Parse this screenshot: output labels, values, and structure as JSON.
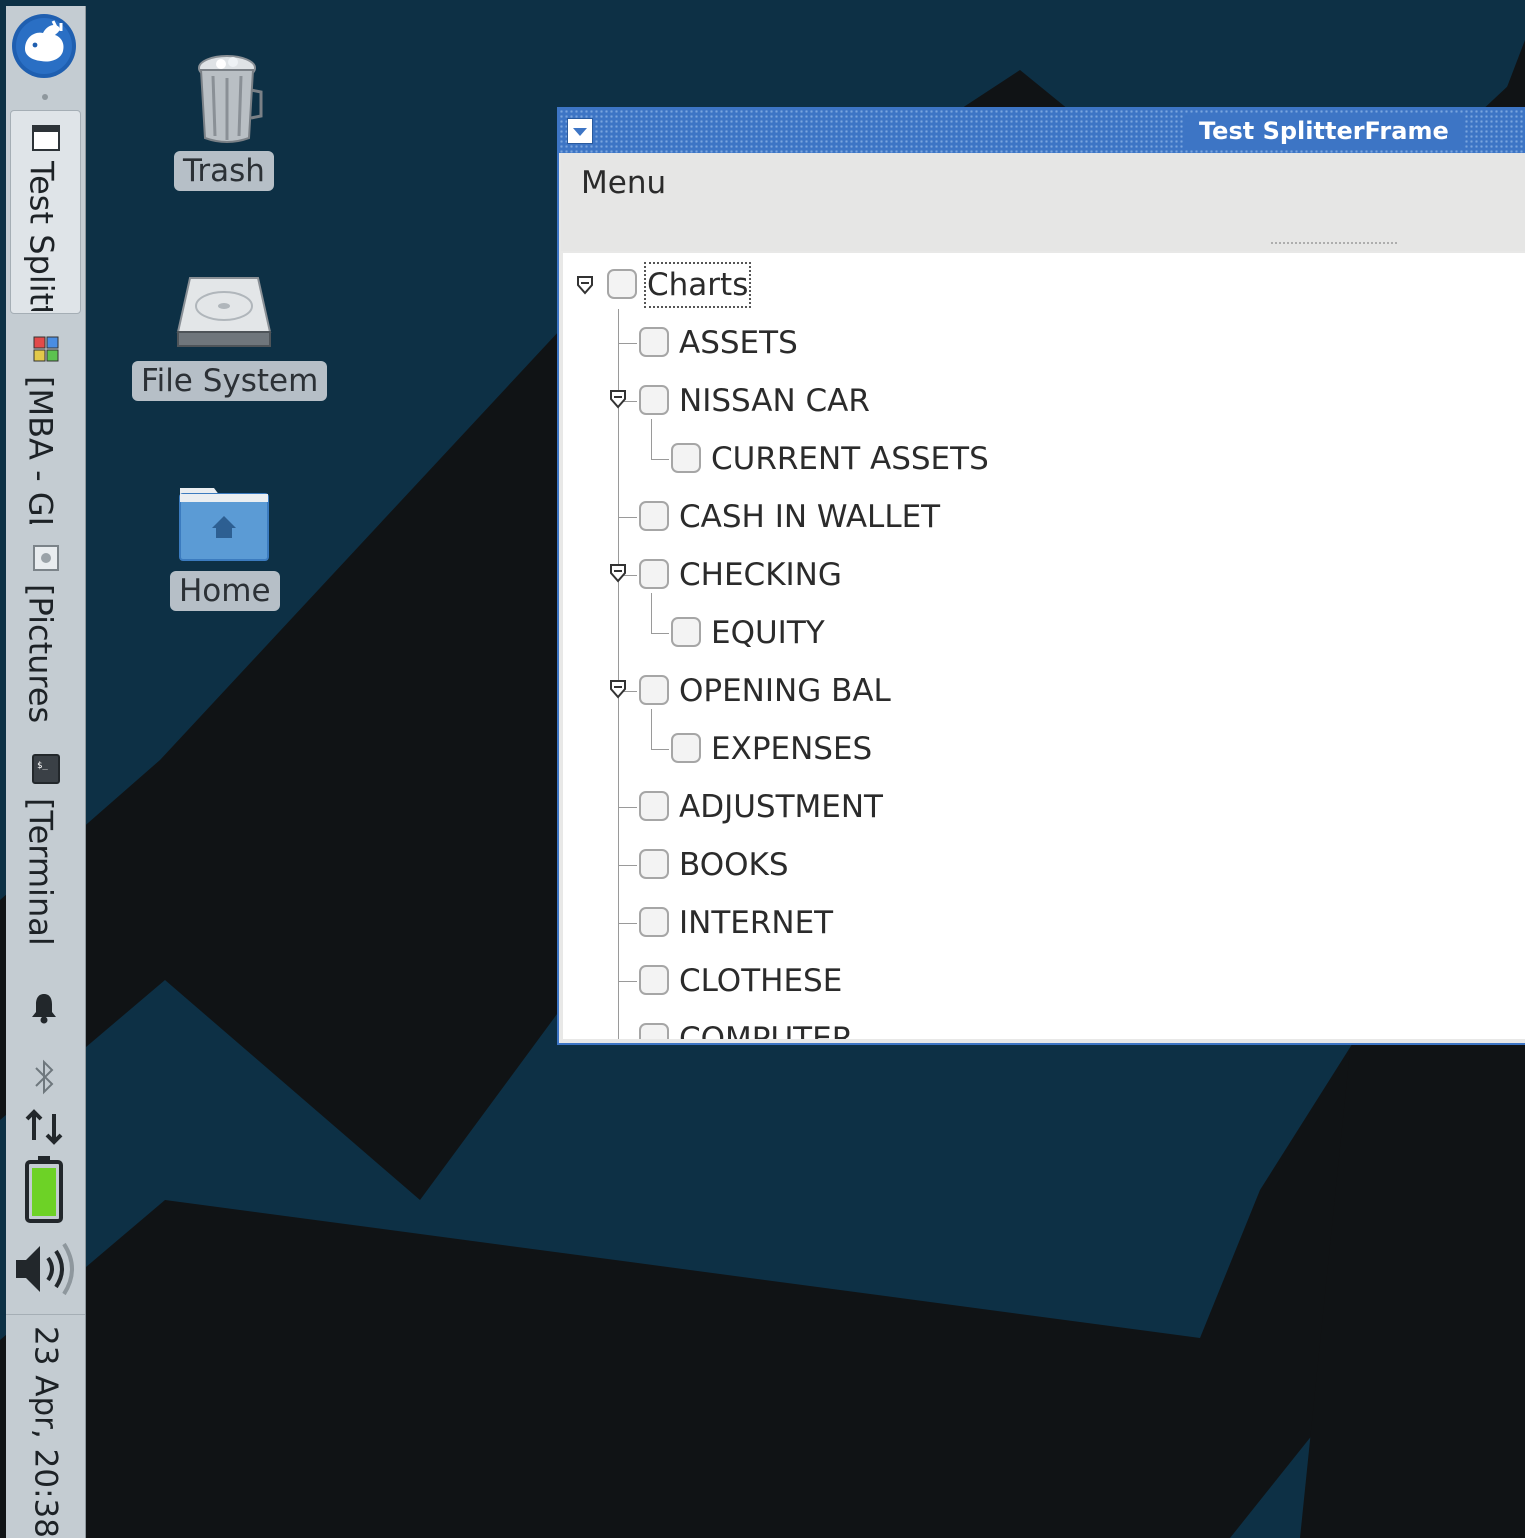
{
  "panel": {
    "tasks": [
      {
        "label": "Test Splitt",
        "icon": "window-icon"
      },
      {
        "label": "[MBA - GL",
        "icon": "app-grid-icon"
      },
      {
        "label": "[Pictures ·",
        "icon": "image-viewer-icon"
      },
      {
        "label": "[Terminal",
        "icon": "terminal-icon"
      }
    ],
    "clock": "23 Apr, 20:38",
    "tray": [
      "notification-bell-icon",
      "bluetooth-icon",
      "network-icon",
      "battery-icon",
      "volume-icon"
    ]
  },
  "desktop": {
    "icons": [
      {
        "label": "Trash",
        "icon": "trash-icon"
      },
      {
        "label": "File System",
        "icon": "hard-drive-icon"
      },
      {
        "label": "Home",
        "icon": "home-folder-icon"
      }
    ]
  },
  "window": {
    "title": "Test SplitterFrame",
    "menu_label": "Menu",
    "accent": "#3d75c5",
    "tree": {
      "root": "Charts",
      "items": [
        {
          "label": "ASSETS",
          "level": 1,
          "expanded": false
        },
        {
          "label": "NISSAN CAR",
          "level": 1,
          "expanded": true
        },
        {
          "label": "CURRENT ASSETS",
          "level": 2,
          "expanded": false
        },
        {
          "label": "CASH IN WALLET",
          "level": 1,
          "expanded": false
        },
        {
          "label": "CHECKING",
          "level": 1,
          "expanded": true
        },
        {
          "label": "EQUITY",
          "level": 2,
          "expanded": false
        },
        {
          "label": "OPENING BAL",
          "level": 1,
          "expanded": true
        },
        {
          "label": "EXPENSES",
          "level": 2,
          "expanded": false
        },
        {
          "label": "ADJUSTMENT",
          "level": 1,
          "expanded": false
        },
        {
          "label": "BOOKS",
          "level": 1,
          "expanded": false
        },
        {
          "label": "INTERNET",
          "level": 1,
          "expanded": false
        },
        {
          "label": "CLOTHESE",
          "level": 1,
          "expanded": false
        },
        {
          "label": "COMPUTER",
          "level": 1,
          "expanded": false
        }
      ]
    }
  },
  "colors": {
    "wallpaper_dark": "#101315",
    "wallpaper_blue": "#0d3045",
    "panel_bg": "#c4ccd2",
    "battery_green": "#6dd226"
  }
}
